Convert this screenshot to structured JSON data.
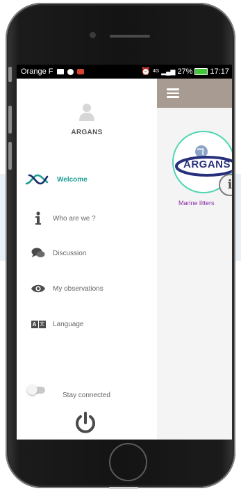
{
  "status_bar": {
    "carrier": "Orange F",
    "network": "4G",
    "battery": "27%",
    "time": "17:17"
  },
  "drawer": {
    "username": "ARGANS",
    "items": [
      {
        "label": "Welcome",
        "icon": "argans-logo-icon",
        "active": true
      },
      {
        "label": "Who are we ?",
        "icon": "info-icon",
        "active": false
      },
      {
        "label": "Discussion",
        "icon": "chat-bubbles-icon",
        "active": false
      },
      {
        "label": "My observations",
        "icon": "eye-icon",
        "active": false
      },
      {
        "label": "Language",
        "icon": "language-icon",
        "active": false
      }
    ],
    "stay_connected_label": "Stay connected",
    "stay_connected": false,
    "language_icon_text": "A",
    "language_icon_text2": "文"
  },
  "main": {
    "logo_text": "ARGANS",
    "info_glyph": "i",
    "card_caption": "Marine litters"
  },
  "colors": {
    "app_bar": "#a89b91",
    "accent": "#1f9d96",
    "caption": "#8a2ca8"
  }
}
